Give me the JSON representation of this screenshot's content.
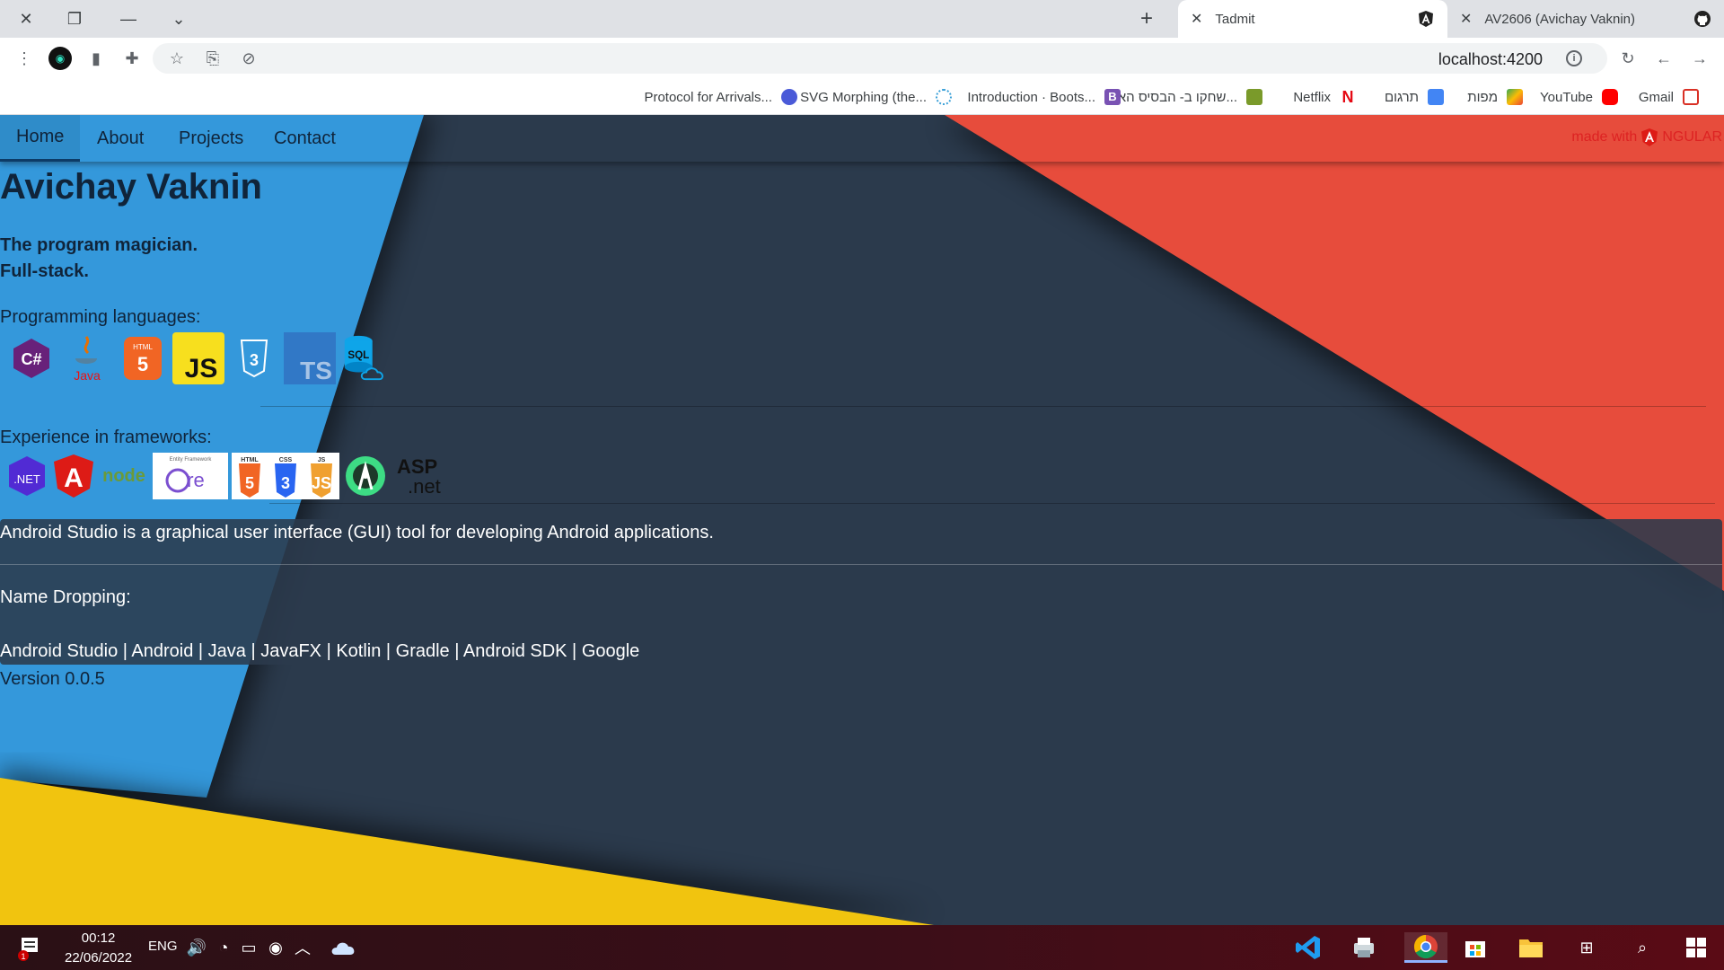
{
  "browser": {
    "tabs": [
      {
        "title": "Tadmit",
        "active": true,
        "icon": "angular-icon"
      },
      {
        "title": "AV2606 (Avichay Vaknin)",
        "active": false,
        "icon": "github-icon"
      }
    ],
    "url": "localhost:4200",
    "bookmarks": [
      {
        "label": "Gmail",
        "icon": "gmail-icon",
        "color": "#d93025"
      },
      {
        "label": "YouTube",
        "icon": "youtube-icon",
        "color": "#ff0000"
      },
      {
        "label": "מפות",
        "icon": "maps-icon",
        "color": "#34a853"
      },
      {
        "label": "תרגום",
        "icon": "translate-icon",
        "color": "#4285f4"
      },
      {
        "label": "Netflix",
        "icon": "netflix-icon",
        "color": "#e50914"
      },
      {
        "label": "שחקו ב- הבסיס הא...",
        "icon": "game-icon",
        "color": "#7a9a2a"
      },
      {
        "label": "Introduction · Boots...",
        "icon": "bootstrap-icon",
        "color": "#7952b3"
      },
      {
        "label": "SVG Morphing (the...",
        "icon": "svg-icon",
        "color": "#3aa0d8"
      },
      {
        "label": "Protocol for Arrivals...",
        "icon": "protocol-icon",
        "color": "#4a5ad8"
      }
    ]
  },
  "nav": {
    "items": [
      "Home",
      "About",
      "Projects",
      "Contact"
    ],
    "active": "Home",
    "made_with": "made with",
    "made_with_brand": "NGULAR"
  },
  "profile": {
    "name": "Avichay Vaknin",
    "tagline1": "The program magician.",
    "tagline2": "Full-stack.",
    "languages_label": "Programming languages:",
    "languages": [
      {
        "icon": "csharp-icon",
        "text": "C#"
      },
      {
        "icon": "java-icon",
        "text": "Java"
      },
      {
        "icon": "html5-icon",
        "text": "HTML"
      },
      {
        "icon": "javascript-icon",
        "text": "JS"
      },
      {
        "icon": "css3-icon",
        "text": "3"
      },
      {
        "icon": "typescript-icon",
        "text": "TS"
      },
      {
        "icon": "sql-icon",
        "text": "SQL"
      }
    ],
    "frameworks_label": "Experience in frameworks:",
    "frameworks": [
      {
        "icon": "dotnet-icon",
        "text": ".NET"
      },
      {
        "icon": "angular-icon",
        "text": "A"
      },
      {
        "icon": "nodejs-icon",
        "text": "node"
      },
      {
        "icon": "entity-framework-core-icon",
        "text": "Core",
        "caption": "Entity Framework"
      },
      {
        "icon": "html-css-js-icon",
        "labels": [
          "HTML",
          "CSS",
          "JS"
        ]
      },
      {
        "icon": "android-studio-icon",
        "text": ""
      },
      {
        "icon": "aspnet-icon",
        "text": "ASP",
        "text2": ".net"
      }
    ]
  },
  "info": {
    "description": "Android Studio is a graphical user interface (GUI) tool for developing Android applications.",
    "name_dropping_label": "Name Dropping:",
    "name_dropping": "Android Studio | Android | Java | JavaFX | Kotlin | Gradle | Android SDK | Google"
  },
  "version": "Version 0.0.5",
  "taskbar": {
    "time": "00:12",
    "date": "22/06/2022",
    "language": "ENG",
    "notification_count": "1"
  },
  "colors": {
    "blue": "#3498db",
    "dark": "#2b3a4c",
    "red": "#e74c3c",
    "yellow": "#f1c40f"
  }
}
